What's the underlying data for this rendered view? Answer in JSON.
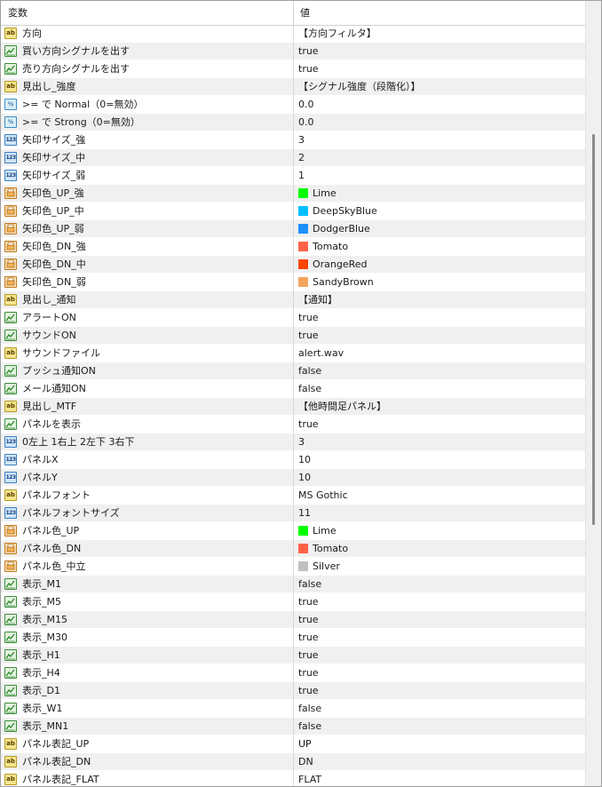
{
  "header": {
    "col_name": "変数",
    "col_value": "値"
  },
  "icons": {
    "ab": "text-type-icon",
    "bool": "bool-type-icon",
    "dbl": "double-type-icon",
    "int": "integer-type-icon",
    "clr": "color-type-icon"
  },
  "rows": [
    {
      "type": "ab",
      "name": "方向",
      "value": "【方向フィルタ】"
    },
    {
      "type": "bool",
      "name": "買い方向シグナルを出す",
      "value": "true"
    },
    {
      "type": "bool",
      "name": "売り方向シグナルを出す",
      "value": "true"
    },
    {
      "type": "ab",
      "name": "見出し_強度",
      "value": "【シグナル強度（段階化）】"
    },
    {
      "type": "dbl",
      "name": ">= で Normal（0=無効）",
      "value": "0.0"
    },
    {
      "type": "dbl",
      "name": ">= で Strong（0=無効）",
      "value": "0.0"
    },
    {
      "type": "int",
      "name": "矢印サイズ_強",
      "value": "3"
    },
    {
      "type": "int",
      "name": "矢印サイズ_中",
      "value": "2"
    },
    {
      "type": "int",
      "name": "矢印サイズ_弱",
      "value": "1"
    },
    {
      "type": "clr",
      "name": "矢印色_UP_強",
      "value": "Lime",
      "color": "#00ff00"
    },
    {
      "type": "clr",
      "name": "矢印色_UP_中",
      "value": "DeepSkyBlue",
      "color": "#00bfff"
    },
    {
      "type": "clr",
      "name": "矢印色_UP_弱",
      "value": "DodgerBlue",
      "color": "#1e90ff"
    },
    {
      "type": "clr",
      "name": "矢印色_DN_強",
      "value": "Tomato",
      "color": "#ff6347"
    },
    {
      "type": "clr",
      "name": "矢印色_DN_中",
      "value": "OrangeRed",
      "color": "#ff4500"
    },
    {
      "type": "clr",
      "name": "矢印色_DN_弱",
      "value": "SandyBrown",
      "color": "#f4a460"
    },
    {
      "type": "ab",
      "name": "見出し_通知",
      "value": "【通知】"
    },
    {
      "type": "bool",
      "name": "アラートON",
      "value": "true"
    },
    {
      "type": "bool",
      "name": "サウンドON",
      "value": "true"
    },
    {
      "type": "ab",
      "name": "サウンドファイル",
      "value": "alert.wav"
    },
    {
      "type": "bool",
      "name": "プッシュ通知ON",
      "value": "false"
    },
    {
      "type": "bool",
      "name": "メール通知ON",
      "value": "false"
    },
    {
      "type": "ab",
      "name": "見出し_MTF",
      "value": "【他時間足パネル】"
    },
    {
      "type": "bool",
      "name": "パネルを表示",
      "value": "true"
    },
    {
      "type": "int",
      "name": "0左上 1右上 2左下 3右下",
      "value": "3"
    },
    {
      "type": "int",
      "name": "パネルX",
      "value": "10"
    },
    {
      "type": "int",
      "name": "パネルY",
      "value": "10"
    },
    {
      "type": "ab",
      "name": "パネルフォント",
      "value": "MS Gothic"
    },
    {
      "type": "int",
      "name": "パネルフォントサイズ",
      "value": "11"
    },
    {
      "type": "clr",
      "name": "パネル色_UP",
      "value": "Lime",
      "color": "#00ff00"
    },
    {
      "type": "clr",
      "name": "パネル色_DN",
      "value": "Tomato",
      "color": "#ff6347"
    },
    {
      "type": "clr",
      "name": "パネル色_中立",
      "value": "Silver",
      "color": "#c0c0c0"
    },
    {
      "type": "bool",
      "name": "表示_M1",
      "value": "false"
    },
    {
      "type": "bool",
      "name": "表示_M5",
      "value": "true"
    },
    {
      "type": "bool",
      "name": "表示_M15",
      "value": "true"
    },
    {
      "type": "bool",
      "name": "表示_M30",
      "value": "true"
    },
    {
      "type": "bool",
      "name": "表示_H1",
      "value": "true"
    },
    {
      "type": "bool",
      "name": "表示_H4",
      "value": "true"
    },
    {
      "type": "bool",
      "name": "表示_D1",
      "value": "true"
    },
    {
      "type": "bool",
      "name": "表示_W1",
      "value": "false"
    },
    {
      "type": "bool",
      "name": "表示_MN1",
      "value": "false"
    },
    {
      "type": "ab",
      "name": "パネル表記_UP",
      "value": "UP"
    },
    {
      "type": "ab",
      "name": "パネル表記_DN",
      "value": "DN"
    },
    {
      "type": "ab",
      "name": "パネル表記_FLAT",
      "value": "FLAT"
    }
  ]
}
